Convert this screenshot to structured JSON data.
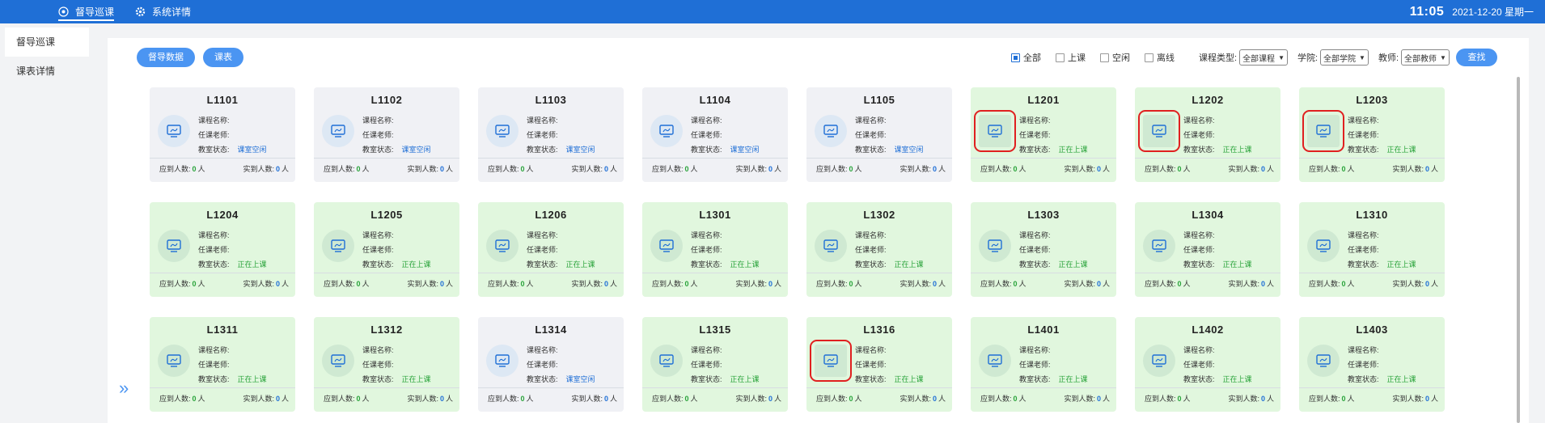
{
  "topbar": {
    "nav": [
      {
        "label": "督导巡课",
        "icon": "eye-icon",
        "active": true
      },
      {
        "label": "系统详情",
        "icon": "gear-icon",
        "active": false
      }
    ],
    "time": "11:05",
    "date": "2021-12-20 星期一",
    "bg_color": "#1f6fd6"
  },
  "sidebar": {
    "items": [
      {
        "label": "督导巡课",
        "active": true
      },
      {
        "label": "课表详情",
        "active": false
      }
    ]
  },
  "toolbar": {
    "tabs": [
      "督导数据",
      "课表"
    ],
    "checkboxes": [
      {
        "label": "全部",
        "checked": true
      },
      {
        "label": "上课",
        "checked": false
      },
      {
        "label": "空闲",
        "checked": false
      },
      {
        "label": "离线",
        "checked": false
      }
    ],
    "course_type_label": "课程类型:",
    "course_type_value": "全部课程",
    "college_label": "学院:",
    "college_value": "全部学院",
    "teacher_label": "教师:",
    "teacher_value": "全部教师",
    "search_label": "查找"
  },
  "card_labels": {
    "course": "课程名称:",
    "teacher": "任课老师:",
    "status": "教室状态:",
    "expected": "应到人数:",
    "actual": "实到人数:",
    "unit": "人"
  },
  "rooms": [
    {
      "name": "L1101",
      "status": "课室空闲",
      "busy": false,
      "highlight": false,
      "expected": "0",
      "actual": "0"
    },
    {
      "name": "L1102",
      "status": "课室空闲",
      "busy": false,
      "highlight": false,
      "expected": "0",
      "actual": "0"
    },
    {
      "name": "L1103",
      "status": "课室空闲",
      "busy": false,
      "highlight": false,
      "expected": "0",
      "actual": "0"
    },
    {
      "name": "L1104",
      "status": "课室空闲",
      "busy": false,
      "highlight": false,
      "expected": "0",
      "actual": "0"
    },
    {
      "name": "L1105",
      "status": "课室空闲",
      "busy": false,
      "highlight": false,
      "expected": "0",
      "actual": "0"
    },
    {
      "name": "L1201",
      "status": "正在上课",
      "busy": true,
      "highlight": true,
      "expected": "0",
      "actual": "0"
    },
    {
      "name": "L1202",
      "status": "正在上课",
      "busy": true,
      "highlight": true,
      "expected": "0",
      "actual": "0"
    },
    {
      "name": "L1203",
      "status": "正在上课",
      "busy": true,
      "highlight": true,
      "expected": "0",
      "actual": "0"
    },
    {
      "name": "L1204",
      "status": "正在上课",
      "busy": true,
      "highlight": false,
      "expected": "0",
      "actual": "0"
    },
    {
      "name": "L1205",
      "status": "正在上课",
      "busy": true,
      "highlight": false,
      "expected": "0",
      "actual": "0"
    },
    {
      "name": "L1206",
      "status": "正在上课",
      "busy": true,
      "highlight": false,
      "expected": "0",
      "actual": "0"
    },
    {
      "name": "L1301",
      "status": "正在上课",
      "busy": true,
      "highlight": false,
      "expected": "0",
      "actual": "0"
    },
    {
      "name": "L1302",
      "status": "正在上课",
      "busy": true,
      "highlight": false,
      "expected": "0",
      "actual": "0"
    },
    {
      "name": "L1303",
      "status": "正在上课",
      "busy": true,
      "highlight": false,
      "expected": "0",
      "actual": "0"
    },
    {
      "name": "L1304",
      "status": "正在上课",
      "busy": true,
      "highlight": false,
      "expected": "0",
      "actual": "0"
    },
    {
      "name": "L1310",
      "status": "正在上课",
      "busy": true,
      "highlight": false,
      "expected": "0",
      "actual": "0"
    },
    {
      "name": "L1311",
      "status": "正在上课",
      "busy": true,
      "highlight": false,
      "expected": "0",
      "actual": "0"
    },
    {
      "name": "L1312",
      "status": "正在上课",
      "busy": true,
      "highlight": false,
      "expected": "0",
      "actual": "0"
    },
    {
      "name": "L1314",
      "status": "课室空闲",
      "busy": false,
      "highlight": false,
      "expected": "0",
      "actual": "0"
    },
    {
      "name": "L1315",
      "status": "正在上课",
      "busy": true,
      "highlight": false,
      "expected": "0",
      "actual": "0"
    },
    {
      "name": "L1316",
      "status": "正在上课",
      "busy": true,
      "highlight": true,
      "expected": "0",
      "actual": "0"
    },
    {
      "name": "L1401",
      "status": "正在上课",
      "busy": true,
      "highlight": false,
      "expected": "0",
      "actual": "0"
    },
    {
      "name": "L1402",
      "status": "正在上课",
      "busy": true,
      "highlight": false,
      "expected": "0",
      "actual": "0"
    },
    {
      "name": "L1403",
      "status": "正在上课",
      "busy": true,
      "highlight": false,
      "expected": "0",
      "actual": "0"
    }
  ],
  "colors": {
    "idle_status": "#1f6fd6",
    "busy_status": "#29a33a",
    "highlight": "#e02020"
  },
  "expand_icon": "double-chevron-right-icon"
}
